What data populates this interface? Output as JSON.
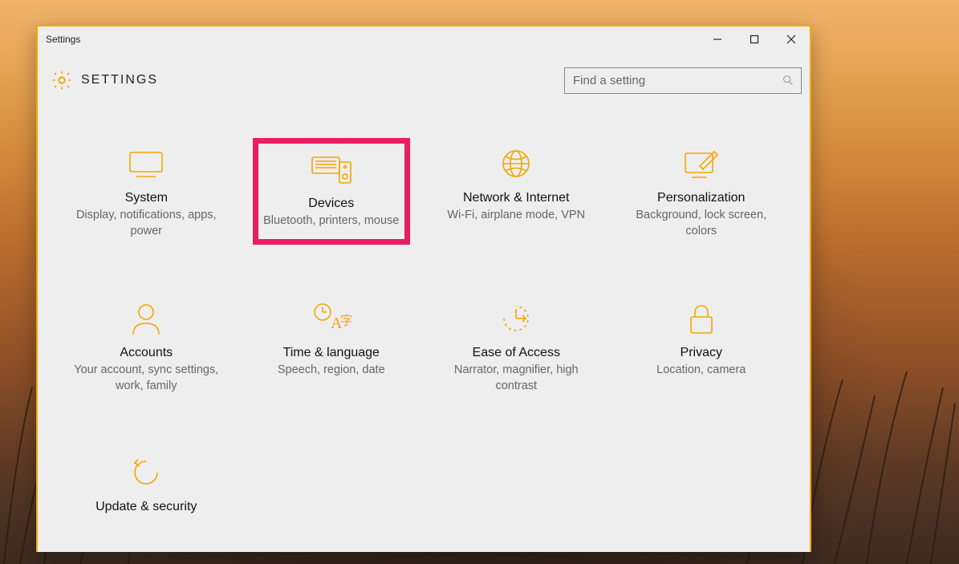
{
  "window": {
    "title": "Settings",
    "app_title": "SETTINGS"
  },
  "search": {
    "placeholder": "Find a setting"
  },
  "tiles": [
    {
      "name": "System",
      "desc": "Display, notifications, apps, power"
    },
    {
      "name": "Devices",
      "desc": "Bluetooth, printers, mouse"
    },
    {
      "name": "Network & Internet",
      "desc": "Wi-Fi, airplane mode, VPN"
    },
    {
      "name": "Personalization",
      "desc": "Background, lock screen, colors"
    },
    {
      "name": "Accounts",
      "desc": "Your account, sync settings, work, family"
    },
    {
      "name": "Time & language",
      "desc": "Speech, region, date"
    },
    {
      "name": "Ease of Access",
      "desc": "Narrator, magnifier, high contrast"
    },
    {
      "name": "Privacy",
      "desc": "Location, camera"
    },
    {
      "name": "Update & security",
      "desc": ""
    }
  ],
  "highlighted_tile_index": 1,
  "accent_color": "#f5a600",
  "highlight_color": "#e81e63"
}
